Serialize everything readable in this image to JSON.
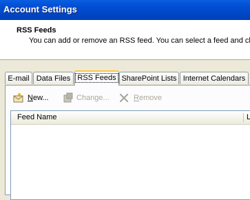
{
  "window": {
    "title": "Account Settings"
  },
  "header": {
    "title": "RSS Feeds",
    "subtitle": "You can add or remove an RSS feed. You can select a feed and cha"
  },
  "tabs": [
    {
      "label": "E-mail"
    },
    {
      "label": "Data Files"
    },
    {
      "label": "RSS Feeds",
      "selected": true
    },
    {
      "label": "SharePoint Lists"
    },
    {
      "label": "Internet Calendars"
    }
  ],
  "toolbar": {
    "new": {
      "label_u": "N",
      "label_rest": "ew...",
      "enabled": true,
      "icon": "new-feed-icon"
    },
    "change": {
      "label_u": "",
      "label_pre": "C",
      "label_rest": "hange...",
      "enabled": false,
      "icon": "change-icon"
    },
    "remove": {
      "label_pre": "",
      "label_u": "R",
      "label_rest": "emove",
      "enabled": false,
      "icon": "remove-x-icon"
    }
  },
  "list": {
    "columns": [
      "Feed Name",
      "L"
    ]
  }
}
